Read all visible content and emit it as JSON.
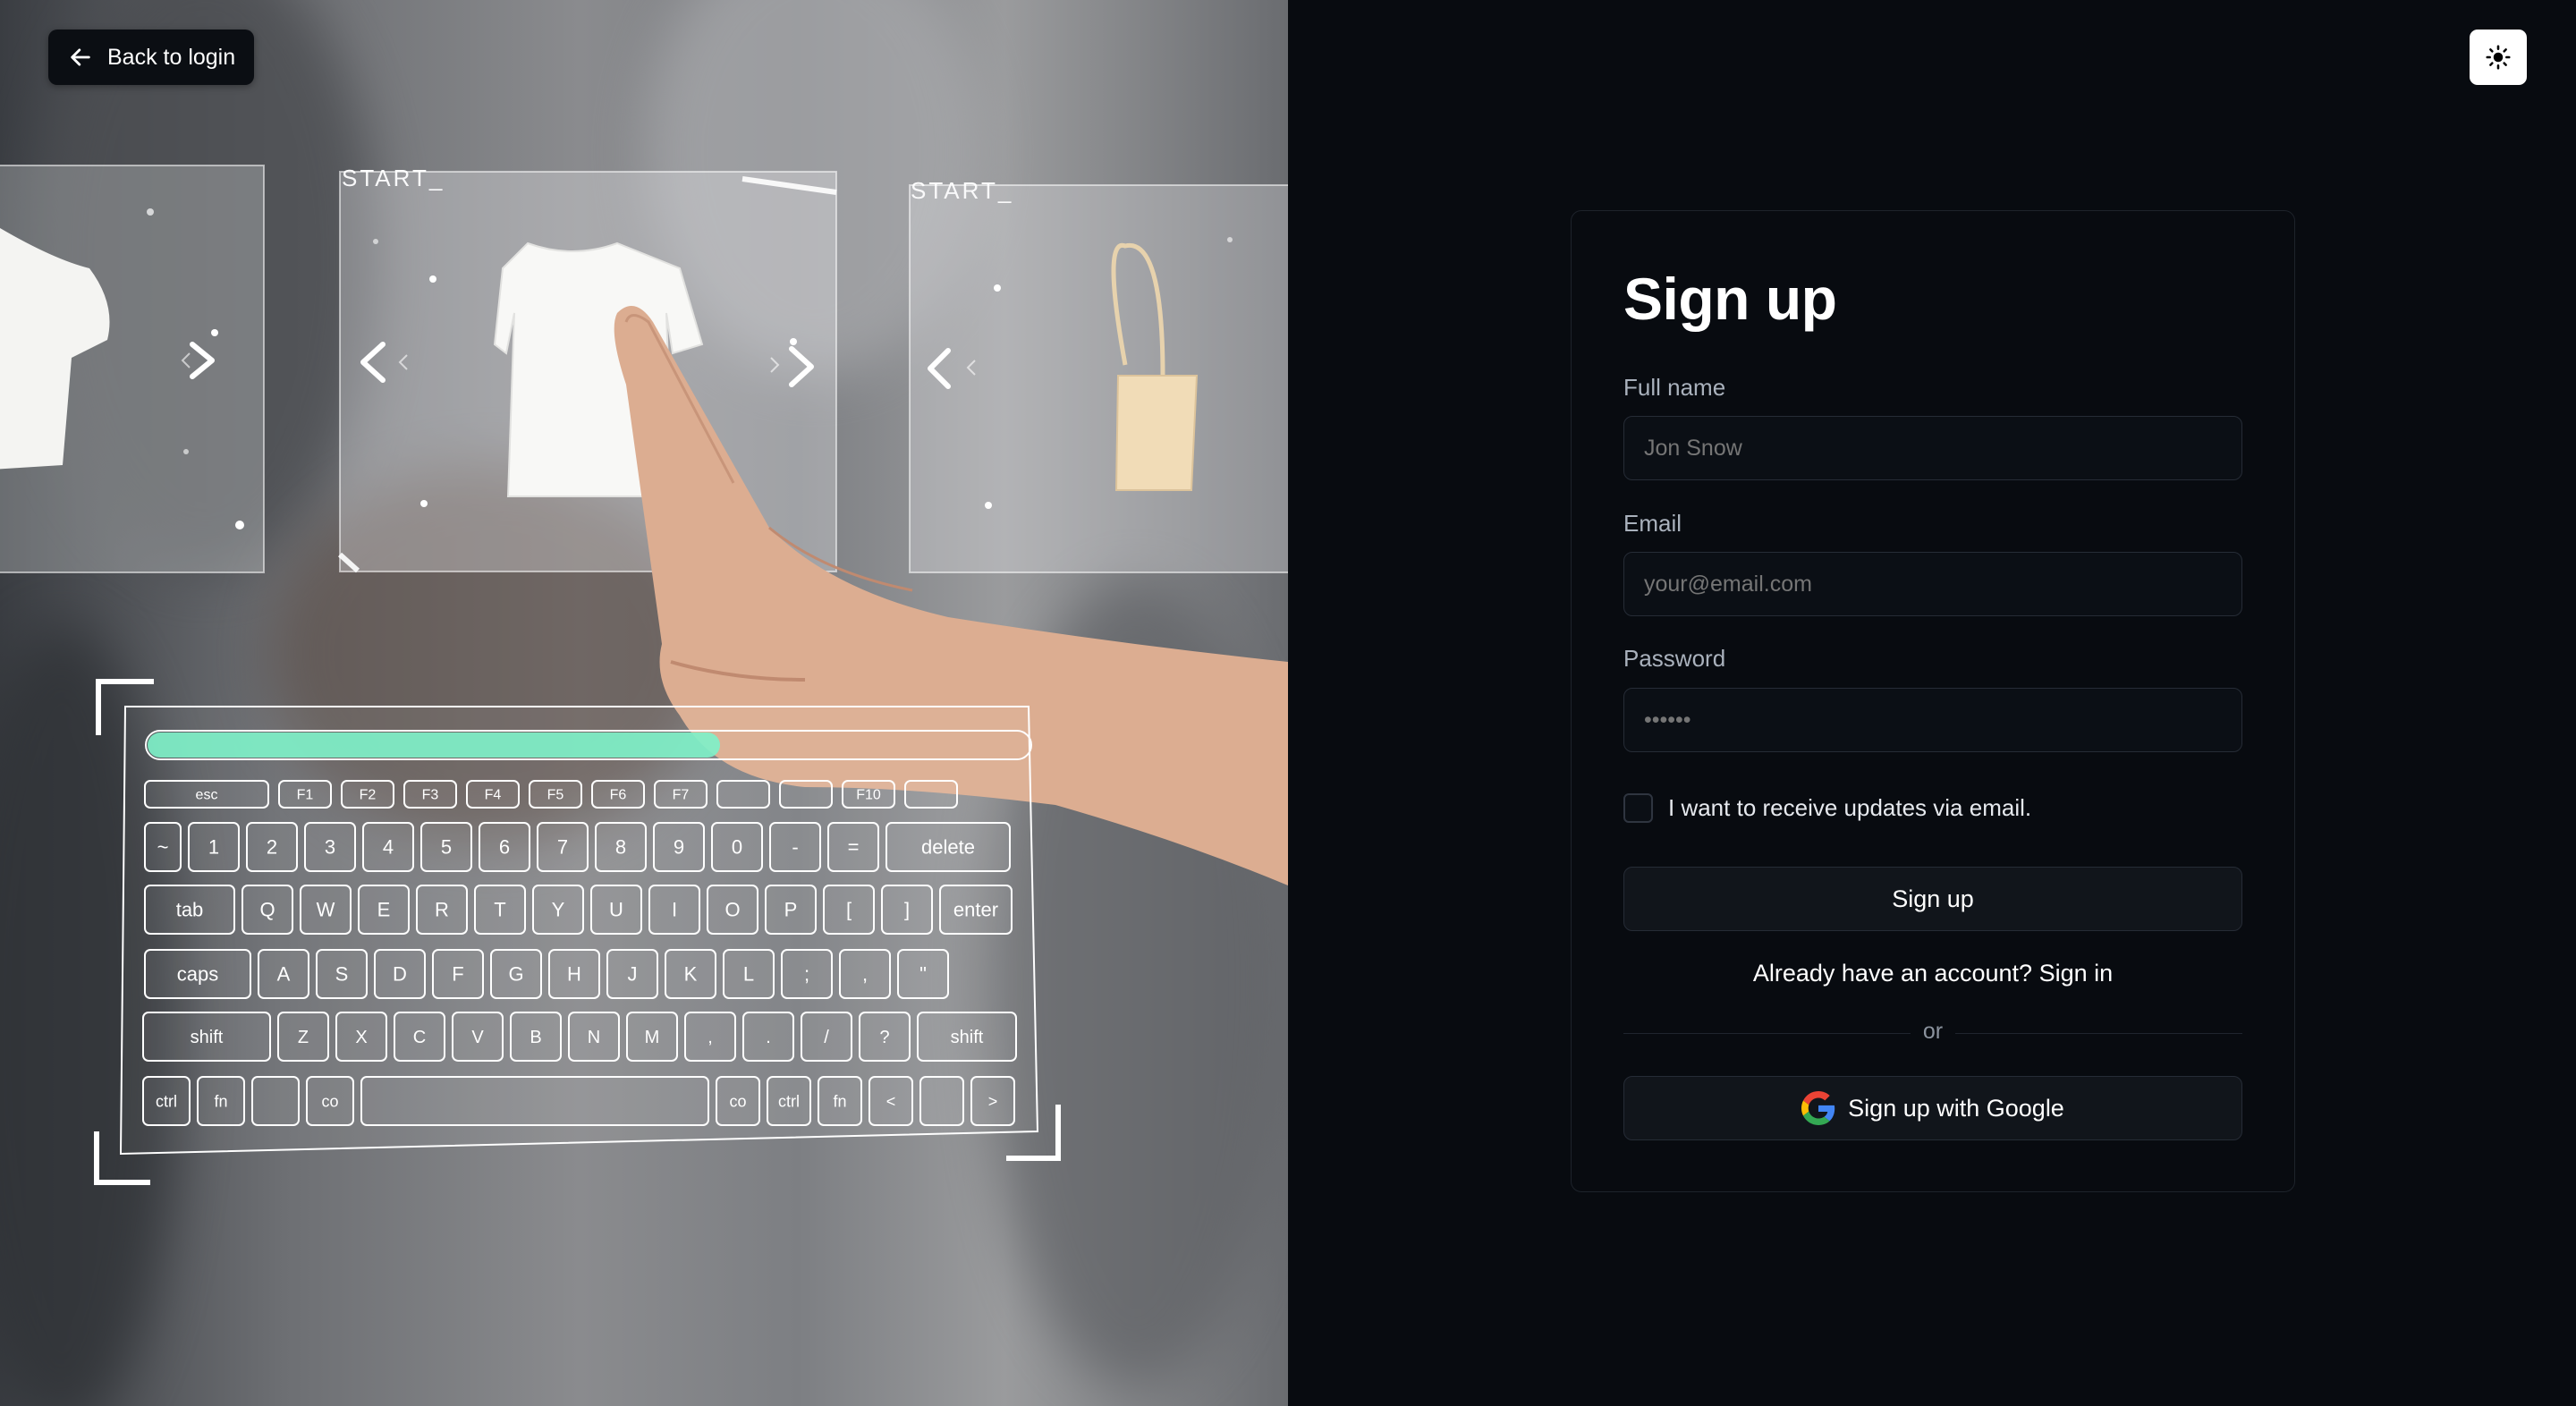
{
  "hero": {
    "back_label": "Back to login",
    "start_labels": [
      "START_",
      "START_"
    ],
    "keyboard": {
      "fn_row": [
        "esc",
        "F1",
        "F2",
        "F3",
        "F4",
        "F5",
        "F6",
        "F7",
        "",
        "",
        "F10",
        ""
      ],
      "num_row": [
        "~",
        "1",
        "2",
        "3",
        "4",
        "5",
        "6",
        "7",
        "8",
        "9",
        "0",
        "-",
        "=",
        "delete"
      ],
      "q_row": [
        "tab",
        "Q",
        "W",
        "E",
        "R",
        "T",
        "Y",
        "U",
        "I",
        "O",
        "P",
        "[",
        "]",
        "enter"
      ],
      "a_row": [
        "caps",
        "A",
        "S",
        "D",
        "F",
        "G",
        "H",
        "J",
        "K",
        "L",
        ";",
        ",",
        "\""
      ],
      "z_row": [
        "shift",
        "Z",
        "X",
        "C",
        "V",
        "B",
        "N",
        "M",
        ",",
        ".",
        "/",
        "?",
        "shift"
      ],
      "bottom_row": [
        "ctrl",
        "fn",
        "",
        "co",
        "",
        "co",
        "ctrl",
        "fn",
        "<",
        "",
        ">"
      ]
    }
  },
  "form": {
    "title": "Sign up",
    "fullname_label": "Full name",
    "fullname_placeholder": "Jon Snow",
    "email_label": "Email",
    "email_placeholder": "your@email.com",
    "password_label": "Password",
    "password_placeholder": "••••••",
    "updates_label": "I want to receive updates via email.",
    "submit_label": "Sign up",
    "signin_text": "Already have an account? Sign in",
    "divider_text": "or",
    "google_label": "Sign up with Google"
  },
  "icons": {
    "back": "arrow-left-icon",
    "theme": "sun-icon",
    "google": "google-icon"
  },
  "colors": {
    "page_bg": "#080b10",
    "card_border": "#1e232b",
    "accent_bar": "#7ff0c8"
  }
}
